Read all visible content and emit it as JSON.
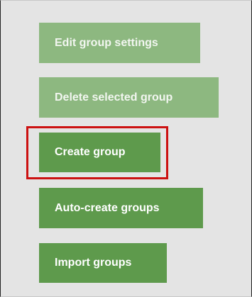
{
  "buttons": {
    "edit_group_settings": "Edit group settings",
    "delete_selected_group": "Delete selected group",
    "create_group": "Create group",
    "auto_create_groups": "Auto-create groups",
    "import_groups": "Import groups"
  },
  "states": {
    "edit_group_settings": "disabled",
    "delete_selected_group": "disabled",
    "create_group": "enabled",
    "auto_create_groups": "enabled",
    "import_groups": "enabled"
  },
  "colors": {
    "panel_background": "#e4e4e4",
    "button_enabled": "#5e9a4c",
    "button_disabled": "#8db880",
    "highlight_border": "#cc1111"
  }
}
